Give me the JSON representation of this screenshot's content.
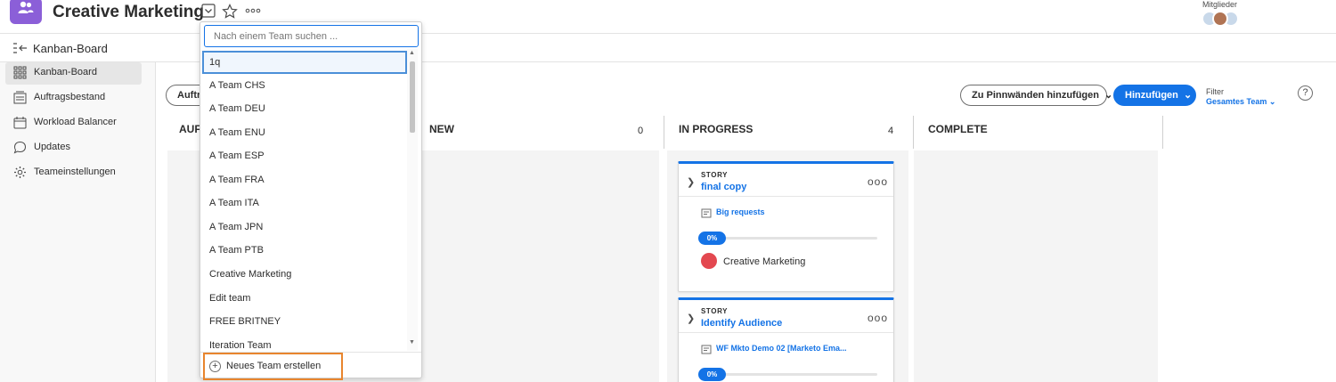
{
  "header": {
    "title": "Creative Marketing",
    "members_label": "Mitglieder"
  },
  "subheader": {
    "title": "Kanban-Board"
  },
  "sidebar": {
    "items": [
      {
        "label": "Kanban-Board",
        "icon": "grid-icon",
        "active": true
      },
      {
        "label": "Auftragsbestand",
        "icon": "backlog-icon"
      },
      {
        "label": "Workload Balancer",
        "icon": "calendar-icon"
      },
      {
        "label": "Updates",
        "icon": "chat-icon"
      },
      {
        "label": "Teameinstellungen",
        "icon": "gear-icon"
      }
    ]
  },
  "toolbar": {
    "left_button": "Auftra",
    "pin_button": "Zu Pinnwänden hinzufügen",
    "add_button": "Hinzufügen",
    "filter_label": "Filter",
    "filter_value": "Gesamtes Team",
    "help": "?"
  },
  "columns": [
    {
      "name": "AUF"
    },
    {
      "name": "NEW",
      "count": "0"
    },
    {
      "name": "IN PROGRESS",
      "count": "4"
    },
    {
      "name": "COMPLETE"
    }
  ],
  "cards": [
    {
      "type": "STORY",
      "name": "final copy",
      "request": "Big requests",
      "progress": "0%",
      "owner": "Creative Marketing"
    },
    {
      "type": "STORY",
      "name": "Identify Audience",
      "request": "WF Mkto Demo 02 [Marketo Ema...",
      "progress": "0%"
    }
  ],
  "dropdown": {
    "search_placeholder": "Nach einem Team suchen ...",
    "options": [
      "1q",
      "A Team CHS",
      "A Team DEU",
      "A Team ENU",
      "A Team ESP",
      "A Team FRA",
      "A Team ITA",
      "A Team JPN",
      "A Team PTB",
      "Creative Marketing",
      "Edit team",
      "FREE BRITNEY",
      "Iteration Team"
    ],
    "new_team_label": "Neues Team erstellen"
  },
  "colors": {
    "accent": "#1473e6",
    "team_avatar": "#8b5fd8",
    "highlight": "#e8852e",
    "owner_badge": "#e34850"
  }
}
